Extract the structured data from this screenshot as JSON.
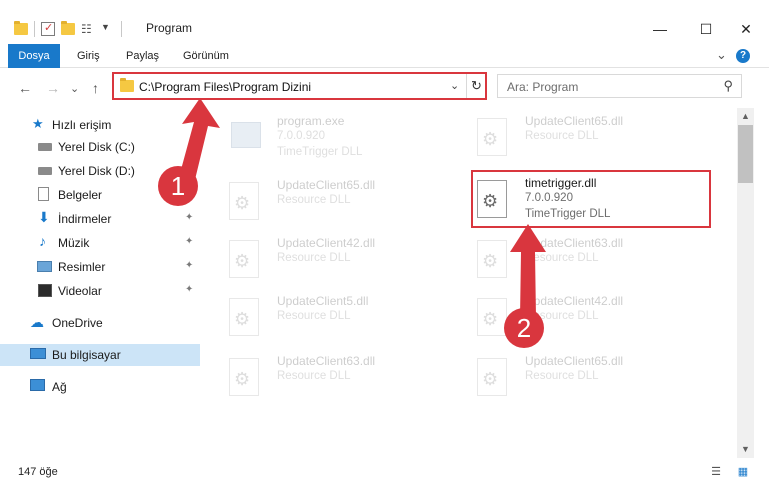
{
  "window": {
    "title": "Program",
    "minimize_glyph": "—",
    "maximize_glyph": "☐",
    "close_glyph": "✕"
  },
  "ribbon": {
    "tabs": [
      "Dosya",
      "Giriş",
      "Paylaş",
      "Görünüm"
    ],
    "expand_glyph": "⌄",
    "help_glyph": "?"
  },
  "nav": {
    "back_glyph": "←",
    "forward_glyph": "→",
    "recent_glyph": "⌄",
    "up_glyph": "↑"
  },
  "address": {
    "path": "C:\\Program Files\\Program Dizini",
    "dropdown_glyph": "⌄",
    "refresh_glyph": "↻"
  },
  "search": {
    "placeholder": "Ara: Program",
    "icon_glyph": "⚲"
  },
  "sidebar": {
    "items": [
      {
        "label": "Hızlı erişim",
        "icon": "star-icon"
      },
      {
        "label": "Yerel Disk (C:)",
        "icon": "drive-icon"
      },
      {
        "label": "Yerel Disk (D:)",
        "icon": "drive-icon"
      },
      {
        "label": "Belgeler",
        "icon": "documents-icon"
      },
      {
        "label": "İndirmeler",
        "icon": "download-icon"
      },
      {
        "label": "Müzik",
        "icon": "music-icon"
      },
      {
        "label": "Resimler",
        "icon": "pictures-icon"
      },
      {
        "label": "Videolar",
        "icon": "video-icon"
      },
      {
        "label": "OneDrive",
        "icon": "cloud-icon"
      },
      {
        "label": "Bu bilgisayar",
        "icon": "computer-icon"
      },
      {
        "label": "Ağ",
        "icon": "network-icon"
      }
    ],
    "pin_glyph": "📌"
  },
  "files": [
    {
      "name": "program.exe",
      "version": "7.0.0.920",
      "desc": "TimeTrigger DLL",
      "kind": "exe"
    },
    {
      "name": "UpdateClient65.dll",
      "version": "",
      "desc": "Resource DLL",
      "kind": "dll"
    },
    {
      "name": "UpdateClient65.dll",
      "version": "",
      "desc": "Resource DLL",
      "kind": "dll"
    },
    {
      "name": "timetrigger.dll",
      "version": "7.0.0.920",
      "desc": "TimeTrigger DLL",
      "kind": "dll"
    },
    {
      "name": "UpdateClient42.dll",
      "version": "",
      "desc": "Resource DLL",
      "kind": "dll"
    },
    {
      "name": "UpdateClient63.dll",
      "version": "",
      "desc": "Resource DLL",
      "kind": "dll"
    },
    {
      "name": "UpdateClient5.dll",
      "version": "",
      "desc": "Resource DLL",
      "kind": "dll"
    },
    {
      "name": "UpdateClient42.dll",
      "version": "",
      "desc": "Resource DLL",
      "kind": "dll"
    },
    {
      "name": "UpdateClient63.dll",
      "version": "",
      "desc": "Resource DLL",
      "kind": "dll"
    },
    {
      "name": "UpdateClient65.dll",
      "version": "",
      "desc": "Resource DLL",
      "kind": "dll"
    }
  ],
  "status": {
    "count": "147 öğe",
    "details_view_glyph": "☰",
    "tiles_view_glyph": "▦"
  },
  "annotations": {
    "badge1": "1",
    "badge2": "2",
    "color": "#d9363e"
  },
  "colors": {
    "accent": "#1979ca",
    "selected": "#cce4f7",
    "highlight": "#d9363e"
  }
}
